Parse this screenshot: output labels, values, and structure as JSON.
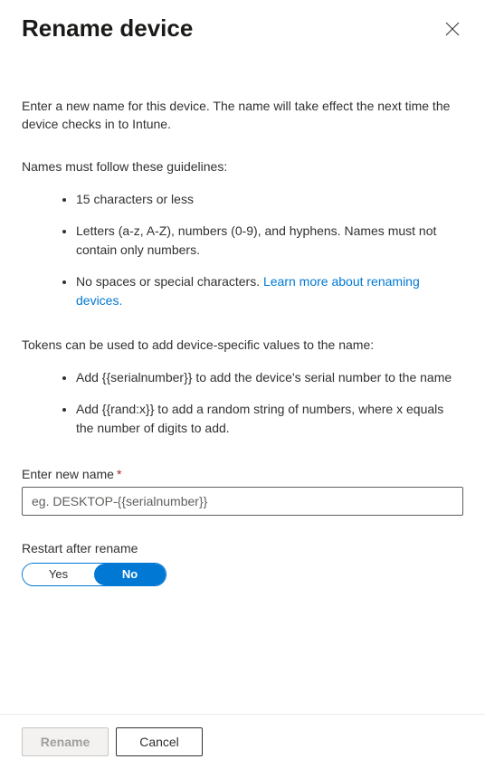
{
  "header": {
    "title": "Rename device"
  },
  "intro": "Enter a new name for this device. The name will take effect the next time the device checks in to Intune.",
  "guidelines": {
    "title": "Names must follow these guidelines:",
    "items": [
      "15 characters or less",
      "Letters (a-z, A-Z), numbers (0-9), and hyphens. Names must not contain only numbers.",
      "No spaces or special characters. "
    ],
    "learn_more": "Learn more about renaming devices."
  },
  "tokens": {
    "title": "Tokens can be used to add device-specific values to the name:",
    "items": [
      "Add {{serialnumber}} to add the device's serial number to the name",
      "Add {{rand:x}} to add a random string of numbers, where x equals the number of digits to add."
    ]
  },
  "name_field": {
    "label": "Enter new name",
    "required_marker": "*",
    "placeholder": "eg. DESKTOP-{{serialnumber}}",
    "value": ""
  },
  "restart": {
    "label": "Restart after rename",
    "option_yes": "Yes",
    "option_no": "No",
    "selected": "No"
  },
  "footer": {
    "primary": "Rename",
    "secondary": "Cancel"
  }
}
